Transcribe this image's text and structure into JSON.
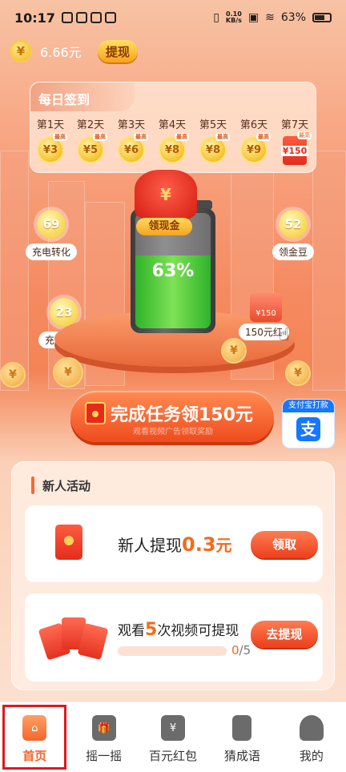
{
  "status_bar": {
    "time": "10:17",
    "net_speed_value": "0.10",
    "net_speed_unit": "KB/s",
    "battery_pct": "63%"
  },
  "balance": {
    "currency_symbol": "¥",
    "amount": "6.66元",
    "withdraw_label": "提现"
  },
  "checkin": {
    "title": "每日签到",
    "days": [
      {
        "label": "第1天",
        "value": "¥3",
        "tag": "最高"
      },
      {
        "label": "第2天",
        "value": "¥5",
        "tag": "最高"
      },
      {
        "label": "第3天",
        "value": "¥6",
        "tag": "最高"
      },
      {
        "label": "第4天",
        "value": "¥8",
        "tag": "最高"
      },
      {
        "label": "第5天",
        "value": "¥8",
        "tag": "最高"
      },
      {
        "label": "第6天",
        "value": "¥9",
        "tag": "最高"
      },
      {
        "label": "第7天",
        "value": "¥150",
        "tag": "最高"
      }
    ]
  },
  "bubbles": {
    "charge_convert": {
      "value": "69",
      "label": "充电转化"
    },
    "gold_beans": {
      "value": "52",
      "label": "领金豆"
    },
    "charge_reward": {
      "value": "23",
      "label": "充电奖励"
    }
  },
  "battery": {
    "percent_label": "63%",
    "level": 0.63,
    "redbag_symbol": "¥",
    "claim_label": "领现金"
  },
  "envelope_reward": {
    "value": "¥150",
    "label": "150元红"
  },
  "task_cta": {
    "main": "完成任务领150元",
    "sub": "观看视频广告领取奖励"
  },
  "alipay": {
    "title": "支付宝打款",
    "logo": "支"
  },
  "newbie": {
    "title": "新人活动",
    "card1": {
      "prefix": "新人提现",
      "amount": "0.3",
      "unit": "元",
      "button": "领取"
    },
    "card2": {
      "prefix": "观看",
      "count": "5",
      "suffix": "次视频可提现",
      "progress_current": "0",
      "progress_total": "/5",
      "progress": 0,
      "button": "去提现"
    }
  },
  "bottom_nav": {
    "items": [
      {
        "label": "首页",
        "icon": "home-icon"
      },
      {
        "label": "摇一摇",
        "icon": "gift-icon"
      },
      {
        "label": "百元红包",
        "icon": "red-packet-icon"
      },
      {
        "label": "猜成语",
        "icon": "book-icon"
      },
      {
        "label": "我的",
        "icon": "user-icon"
      }
    ],
    "active_index": 0
  },
  "colors": {
    "accent": "#f26b1d",
    "active_outline": "#e3161b",
    "alipay_blue": "#1677ff"
  }
}
